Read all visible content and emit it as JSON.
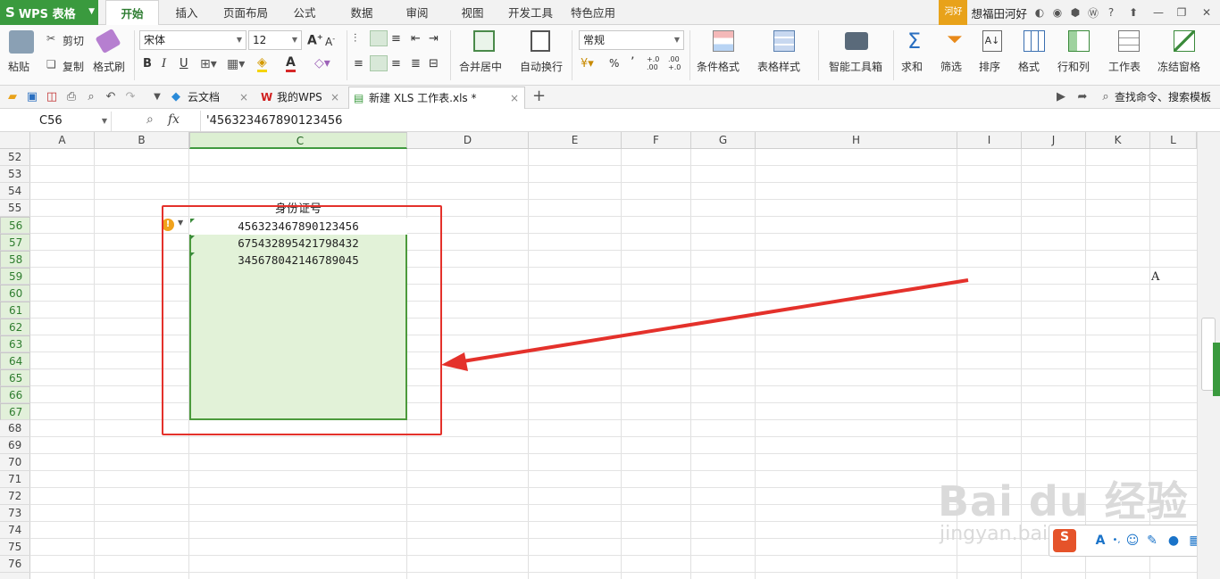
{
  "app": {
    "logo_text": "WPS 表格",
    "logo_mark": "S"
  },
  "menu": {
    "tabs": [
      "开始",
      "插入",
      "页面布局",
      "公式",
      "数据",
      "审阅",
      "视图",
      "开发工具",
      "特色应用"
    ],
    "active": "开始",
    "badge": "河好",
    "username": "想福田河好"
  },
  "ribbon": {
    "paste": "粘贴",
    "cut": "剪切",
    "copy": "复制",
    "format_painter": "格式刷",
    "font_name": "宋体",
    "font_size": "12",
    "merge_center": "合并居中",
    "wrap_text": "自动换行",
    "number_format": "常规",
    "cond_format": "条件格式",
    "table_style": "表格样式",
    "smart_toolbox": "智能工具箱",
    "sum": "求和",
    "filter": "筛选",
    "sort": "排序",
    "format": "格式",
    "rows_cols": "行和列",
    "worksheet": "工作表",
    "freeze": "冻结窗格",
    "bold": "B",
    "italic": "I",
    "underline": "U",
    "percent": "%",
    "comma": "’",
    "inc_decimal": "+.0\n.00",
    "dec_decimal": ".00\n+.0"
  },
  "toolbar": {
    "doc_tabs": [
      {
        "label": "云文档"
      },
      {
        "label": "我的WPS"
      },
      {
        "label": "新建 XLS 工作表.xls *"
      }
    ],
    "search_label": "查找命令、搜索模板",
    "new_tab": "+"
  },
  "formula_bar": {
    "cell_ref": "C56",
    "fx": "fx",
    "content": "'456323467890123456"
  },
  "grid": {
    "columns": [
      "A",
      "B",
      "C",
      "D",
      "E",
      "F",
      "G",
      "H",
      "I",
      "J",
      "K",
      "L"
    ],
    "rows": [
      "52",
      "53",
      "54",
      "55",
      "56",
      "57",
      "58",
      "59",
      "60",
      "61",
      "62",
      "63",
      "64",
      "65",
      "66",
      "67",
      "68",
      "69",
      "70",
      "71",
      "72",
      "73",
      "74",
      "75",
      "76"
    ],
    "header_cell": "身份证号",
    "values": [
      "456323467890123456",
      "675432895421798432",
      "345678042146789045"
    ],
    "stray_text": "A"
  },
  "watermark": {
    "main": "Bai du 经验",
    "sub": "jingyan.baidu.com"
  },
  "colors": {
    "accent": "#3a9a3e",
    "annotation": "#e4312b",
    "selection_fill": "#e2f2d8"
  }
}
